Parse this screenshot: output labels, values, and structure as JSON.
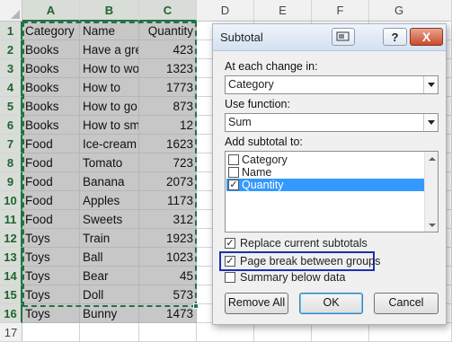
{
  "sheet": {
    "columns": [
      "A",
      "B",
      "C",
      "D",
      "E",
      "F",
      "G"
    ],
    "rows": [
      {
        "num": "1",
        "a": "Category",
        "b": "Name",
        "c": "Quantity"
      },
      {
        "num": "2",
        "a": "Books",
        "b": "Have a gre",
        "c": "423"
      },
      {
        "num": "3",
        "a": "Books",
        "b": "How to wo",
        "c": "1323"
      },
      {
        "num": "4",
        "a": "Books",
        "b": "How to",
        "c": "1773"
      },
      {
        "num": "5",
        "a": "Books",
        "b": "How to go",
        "c": "873"
      },
      {
        "num": "6",
        "a": "Books",
        "b": "How to sm",
        "c": "12"
      },
      {
        "num": "7",
        "a": "Food",
        "b": "Ice-cream",
        "c": "1623"
      },
      {
        "num": "8",
        "a": "Food",
        "b": "Tomato",
        "c": "723"
      },
      {
        "num": "9",
        "a": "Food",
        "b": "Banana",
        "c": "2073"
      },
      {
        "num": "10",
        "a": "Food",
        "b": "Apples",
        "c": "1173"
      },
      {
        "num": "11",
        "a": "Food",
        "b": "Sweets",
        "c": "312"
      },
      {
        "num": "12",
        "a": "Toys",
        "b": "Train",
        "c": "1923"
      },
      {
        "num": "13",
        "a": "Toys",
        "b": "Ball",
        "c": "1023"
      },
      {
        "num": "14",
        "a": "Toys",
        "b": "Bear",
        "c": "45"
      },
      {
        "num": "15",
        "a": "Toys",
        "b": "Doll",
        "c": "573"
      },
      {
        "num": "16",
        "a": "Toys",
        "b": "Bunny",
        "c": "1473"
      },
      {
        "num": "17",
        "a": "",
        "b": "",
        "c": ""
      }
    ]
  },
  "dialog": {
    "title": "Subtotal",
    "help_label": "?",
    "close_label": "X",
    "at_each_change_label": "At each change in:",
    "at_each_change_value": "Category",
    "use_function_label": "Use function:",
    "use_function_value": "Sum",
    "add_subtotal_label": "Add subtotal to:",
    "subtotal_fields": [
      {
        "label": "Category",
        "checked": false
      },
      {
        "label": "Name",
        "checked": false
      },
      {
        "label": "Quantity",
        "checked": true
      }
    ],
    "options": [
      {
        "label": "Replace current subtotals",
        "checked": true
      },
      {
        "label": "Page break between groups",
        "checked": true
      },
      {
        "label": "Summary below data",
        "checked": false
      }
    ],
    "remove_all_label": "Remove All",
    "ok_label": "OK",
    "cancel_label": "Cancel"
  },
  "colors": {
    "selection_green": "#217346",
    "shaded_cell": "#c7c7c7",
    "highlight_blue": "#3399ff",
    "focus_outline": "#1c2fb0"
  }
}
